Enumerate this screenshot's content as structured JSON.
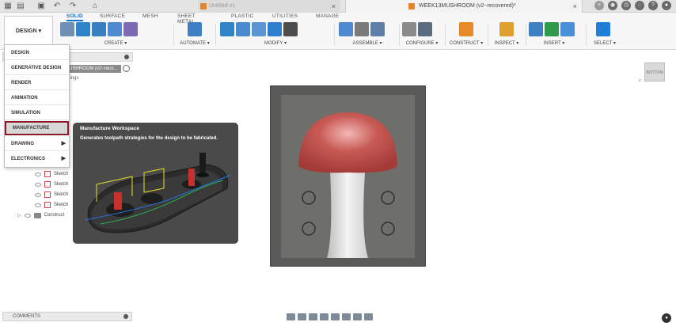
{
  "titlebar": {
    "tabs": [
      {
        "label": "Untitled v1",
        "state": "inactive"
      },
      {
        "label": "WEEK13MUSHROOM (v2~recovered)*",
        "state": "active"
      }
    ]
  },
  "ribbon": {
    "workspace_button": "DESIGN ▾",
    "tabs": [
      "SOLID",
      "SURFACE",
      "MESH",
      "SHEET METAL",
      "PLASTIC",
      "UTILITIES",
      "MANAGE"
    ],
    "active_tab": "SOLID",
    "groups": [
      {
        "label": "CREATE ▾",
        "colors": [
          "#6f8fb5",
          "#2f84c8",
          "#3a7fc0",
          "#4f8ad0",
          "#7d6ab5"
        ]
      },
      {
        "label": "AUTOMATE ▾",
        "colors": [
          "#3f7fc4"
        ]
      },
      {
        "label": "MODIFY ▾",
        "colors": [
          "#2f84c8",
          "#4a8bd0",
          "#5c95d4",
          "#2f7ecf",
          "#4d4d4d"
        ]
      },
      {
        "label": "ASSEMBLE ▾",
        "colors": [
          "#4f8ad0",
          "#7b7b7b",
          "#5f7fa8"
        ]
      },
      {
        "label": "CONFIGURE ▾",
        "colors": [
          "#8a8a8a",
          "#5b6c80"
        ]
      },
      {
        "label": "CONSTRUCT ▾",
        "colors": [
          "#e88a2a"
        ]
      },
      {
        "label": "INSPECT ▾",
        "colors": [
          "#e0a030"
        ]
      },
      {
        "label": "INSERT ▾",
        "colors": [
          "#3f7fc4",
          "#2e9a4a",
          "#4a90d9"
        ]
      },
      {
        "label": "SELECT ▾",
        "colors": [
          "#1f7fd6"
        ]
      }
    ]
  },
  "workspace_menu": {
    "items": [
      {
        "label": "DESIGN",
        "has_submenu": false
      },
      {
        "label": "GENERATIVE DESIGN",
        "has_submenu": false
      },
      {
        "label": "RENDER",
        "has_submenu": false
      },
      {
        "label": "ANIMATION",
        "has_submenu": false
      },
      {
        "label": "SIMULATION",
        "has_submenu": false
      },
      {
        "label": "MANUFACTURE",
        "has_submenu": false
      },
      {
        "label": "DRAWING",
        "has_submenu": true
      },
      {
        "label": "ELECTRONICS",
        "has_submenu": true
      }
    ],
    "selected": "MANUFACTURE",
    "submenu_arrow": "▶"
  },
  "tooltip": {
    "title": "Manufacture Workspace",
    "body": "Generates toolpath strategies for the design to be fabricated."
  },
  "browser": {
    "component_row": "USHROOM (v2~reco...",
    "settings_row": "dings",
    "sketches": [
      "Sketch",
      "Sketch",
      "Sketch",
      "Sketch",
      "Sketch"
    ],
    "construction": "Construct"
  },
  "viewcube": {
    "face": "BOTTOM",
    "axis": "z"
  },
  "bottom": {
    "comments_label": "COMMENTS"
  },
  "colors": {
    "accent": "#0b6fcf",
    "selected_outline": "#8b1a2a",
    "tooltip_bg": "#4a4a4a",
    "mushroom_cap": "#c0504d"
  }
}
